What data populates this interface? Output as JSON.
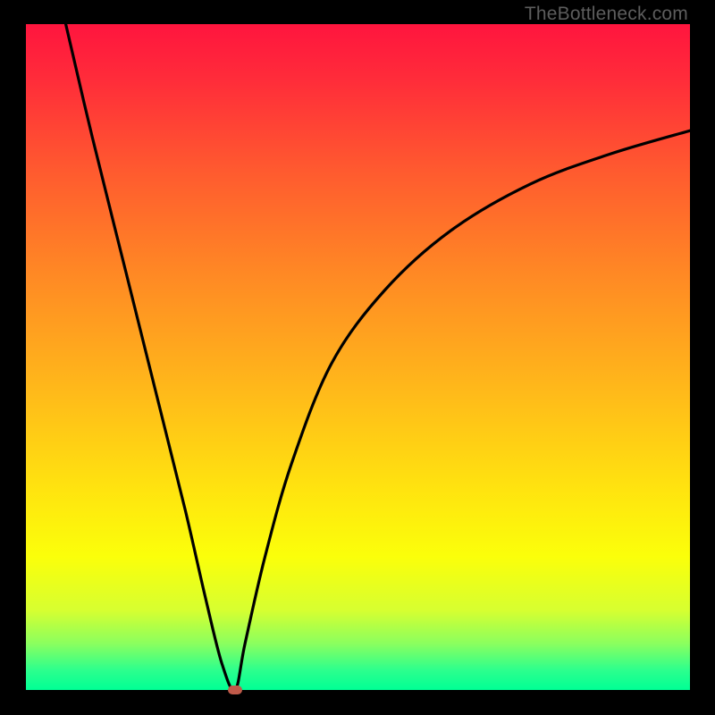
{
  "attribution": "TheBottleneck.com",
  "colors": {
    "frame_bg": "#000000",
    "gradient_top": "#ff153e",
    "gradient_bottom": "#00ff95",
    "curve_stroke": "#000000",
    "marker_fill": "#c05a4a",
    "attribution_text": "#5d5d5d"
  },
  "chart_data": {
    "type": "line",
    "title": "",
    "xlabel": "",
    "ylabel": "",
    "xlim": [
      0,
      100
    ],
    "ylim": [
      0,
      100
    ],
    "series": [
      {
        "name": "left-branch",
        "x": [
          6,
          10,
          15,
          20,
          24,
          27,
          29.5,
          31.5
        ],
        "values": [
          100,
          83,
          63,
          43,
          27,
          14,
          4,
          0
        ]
      },
      {
        "name": "right-branch",
        "x": [
          31.5,
          33,
          36,
          40,
          46,
          54,
          64,
          76,
          88,
          100
        ],
        "values": [
          0,
          7,
          20,
          34,
          49,
          60,
          69,
          76,
          80.5,
          84
        ]
      }
    ],
    "marker": {
      "x": 31.5,
      "y": 0
    },
    "grid": false,
    "legend": false,
    "background_gradient": "red-to-green"
  }
}
